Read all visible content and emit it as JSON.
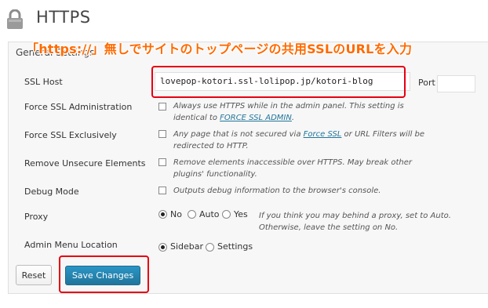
{
  "header": {
    "title": "HTTPS"
  },
  "annotation": {
    "text": "「https://」無しでサイトのトップページの共用SSLのURLを入力"
  },
  "section": {
    "heading": "General Settings"
  },
  "rows": {
    "ssl_host": {
      "label": "SSL Host",
      "value": "lovepop-kotori.ssl-lolipop.jp/kotori-blog",
      "port_label": "Port",
      "port_value": ""
    },
    "force_admin": {
      "label": "Force SSL Administration",
      "desc_before": "Always use HTTPS while in the admin panel. This setting is",
      "desc_line2_before": "identical to ",
      "link": "FORCE SSL ADMIN",
      "desc_after": "."
    },
    "force_exclusive": {
      "label": "Force SSL Exclusively",
      "desc_before": "Any page that is not secured via ",
      "link": "Force SSL",
      "desc_after": " or URL Filters will be",
      "desc_line2": "redirected to HTTP."
    },
    "remove_unsecure": {
      "label": "Remove Unsecure Elements",
      "desc_line1": "Remove elements inaccessible over HTTPS. May break other",
      "desc_line2": "plugins' functionality."
    },
    "debug": {
      "label": "Debug Mode",
      "desc": "Outputs debug information to the browser's console."
    },
    "proxy": {
      "label": "Proxy",
      "options": [
        "No",
        "Auto",
        "Yes"
      ],
      "selected": "No",
      "desc_line1": "If you think you may behind a proxy, set to Auto.",
      "desc_line2": "Otherwise, leave the setting on No."
    },
    "admin_menu": {
      "label": "Admin Menu Location",
      "options": [
        "Sidebar",
        "Settings"
      ],
      "selected": "Sidebar"
    }
  },
  "buttons": {
    "reset": "Reset",
    "save": "Save Changes"
  },
  "colors": {
    "accent": "#21759b",
    "highlight": "#e60012",
    "annotation": "#ff6a00"
  },
  "icons": {
    "header": "lock-icon"
  }
}
